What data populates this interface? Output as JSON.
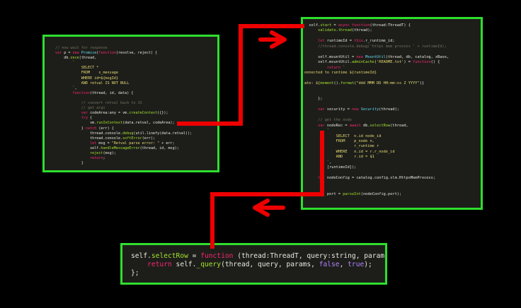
{
  "colors": {
    "background": "#000000",
    "panel_border": "#2ede2e",
    "panel_bg": "#1d1e1a",
    "connector": "#ee0000",
    "text": "#e6e6dc",
    "keyword": "#f92672",
    "function": "#a6e22e",
    "string": "#e6db74",
    "comment": "#75715e",
    "number": "#ae81ff",
    "type": "#66d9ef"
  },
  "panels": {
    "left": {
      "lines": [
        [
          [
            "comment",
            "// now wait for response"
          ]
        ],
        [
          [
            "keyword",
            "var"
          ],
          [
            "text",
            " p = "
          ],
          [
            "keyword",
            "new "
          ],
          [
            "type",
            "Promise"
          ],
          [
            "text",
            "("
          ],
          [
            "keyword",
            "function"
          ],
          [
            "text",
            "(resolve, reject) {"
          ]
        ],
        [
          [
            "text",
            "    db."
          ],
          [
            "function",
            "once"
          ],
          [
            "text",
            "(thread,"
          ]
        ],
        [
          [
            "string",
            "        `"
          ]
        ],
        [
          [
            "string",
            "            SELECT *"
          ]
        ],
        [
          [
            "string",
            "            FROM    x_message"
          ]
        ],
        [
          [
            "string",
            "            WHERE id=${msgId}"
          ]
        ],
        [
          [
            "string",
            "            AND retval IS NOT NULL"
          ]
        ],
        [
          [
            "string",
            "        `"
          ],
          [
            "text",
            ","
          ]
        ],
        [
          [
            "text",
            "        "
          ],
          [
            "keyword",
            "function"
          ],
          [
            "text",
            "(thread, id, data) {"
          ]
        ],
        [],
        [
          [
            "comment",
            "            // convert retval back to JS"
          ]
        ],
        [
          [
            "comment",
            "            // get args"
          ]
        ],
        [
          [
            "text",
            "            "
          ],
          [
            "keyword",
            "var"
          ],
          [
            "text",
            " codeArea:any = vm."
          ],
          [
            "function",
            "createContext"
          ],
          [
            "text",
            "({});"
          ]
        ],
        [
          [
            "text",
            "            "
          ],
          [
            "keyword",
            "try"
          ],
          [
            "text",
            " {"
          ]
        ],
        [
          [
            "text",
            "                vm."
          ],
          [
            "function",
            "runInContext"
          ],
          [
            "text",
            "(data.retval, codeArea);"
          ]
        ],
        [
          [
            "text",
            "            } "
          ],
          [
            "keyword",
            "catch"
          ],
          [
            "text",
            " (err) {"
          ]
        ],
        [
          [
            "text",
            "                thread.console."
          ],
          [
            "function",
            "debug"
          ],
          [
            "text",
            "(util.linefy(data.retval));"
          ]
        ],
        [
          [
            "text",
            "                thread.console."
          ],
          [
            "function",
            "softError"
          ],
          [
            "text",
            "(err);"
          ]
        ],
        [
          [
            "text",
            "                "
          ],
          [
            "keyword",
            "let"
          ],
          [
            "text",
            " msg = "
          ],
          [
            "string",
            "\"Retval parse error: \""
          ],
          [
            "text",
            " + err;"
          ]
        ],
        [
          [
            "text",
            "                self."
          ],
          [
            "function",
            "handleMessageError"
          ],
          [
            "text",
            "(thread, id, msg);"
          ]
        ],
        [
          [
            "text",
            "                "
          ],
          [
            "function",
            "reject"
          ],
          [
            "text",
            "(msg);"
          ]
        ],
        [
          [
            "text",
            "                "
          ],
          [
            "keyword",
            "return"
          ],
          [
            "text",
            ";"
          ]
        ],
        [
          [
            "text",
            "            }"
          ]
        ]
      ]
    },
    "right": {
      "lines": [
        [
          [
            "text",
            "  self."
          ],
          [
            "function",
            "start"
          ],
          [
            "text",
            " = "
          ],
          [
            "keyword",
            "async function"
          ],
          [
            "text",
            "(thread:ThreadT) {"
          ]
        ],
        [
          [
            "text",
            "      "
          ],
          [
            "function",
            "validate"
          ],
          [
            "text",
            "."
          ],
          [
            "function",
            "thread"
          ],
          [
            "text",
            "(thread);"
          ]
        ],
        [],
        [
          [
            "text",
            "      "
          ],
          [
            "keyword",
            "let"
          ],
          [
            "text",
            " runtimeId = "
          ],
          [
            "keyword",
            "this"
          ],
          [
            "text",
            ".r_runtime_id;"
          ]
        ],
        [
          [
            "comment",
            "      //thread.console.debug('https mem process ' + runtimeId);"
          ]
        ],
        [],
        [
          [
            "text",
            "      self.mountUtil = "
          ],
          [
            "keyword",
            "new "
          ],
          [
            "type",
            "MountUtil"
          ],
          [
            "text",
            "(thread, db, catalog, xBase,"
          ]
        ],
        [
          [
            "text",
            "      self.mountUtil."
          ],
          [
            "function",
            "adminCache"
          ],
          [
            "text",
            "("
          ],
          [
            "string",
            "'README.txt'"
          ],
          [
            "text",
            ") = "
          ],
          [
            "keyword",
            "function"
          ],
          [
            "text",
            "() {"
          ]
        ],
        [
          [
            "text",
            "          "
          ],
          [
            "keyword",
            "return"
          ],
          [
            "string",
            " `"
          ]
        ],
        [
          [
            "string",
            "onnected to runtime ${runtimeId}"
          ]
        ],
        [],
        [
          [
            "string",
            "ate: ${"
          ],
          [
            "function",
            "moment"
          ],
          [
            "text",
            "()."
          ],
          [
            "function",
            "format"
          ],
          [
            "text",
            "("
          ],
          [
            "string",
            "\"ddd MMM DD HH:mm:ss Z YYYY\""
          ],
          [
            "text",
            ")}"
          ]
        ],
        [],
        [],
        [
          [
            "text",
            "      };"
          ]
        ],
        [],
        [
          [
            "text",
            "      "
          ],
          [
            "keyword",
            "var"
          ],
          [
            "text",
            " security = "
          ],
          [
            "keyword",
            "new "
          ],
          [
            "type",
            "Security"
          ],
          [
            "text",
            "(thread);"
          ]
        ],
        [],
        [
          [
            "comment",
            "      // get the node"
          ]
        ],
        [
          [
            "text",
            "      "
          ],
          [
            "keyword",
            "var"
          ],
          [
            "text",
            " nodeRec = "
          ],
          [
            "keyword",
            "await"
          ],
          [
            "text",
            " db."
          ],
          [
            "function",
            "selectRow"
          ],
          [
            "text",
            "(thread,"
          ]
        ],
        [
          [
            "string",
            "          `"
          ]
        ],
        [
          [
            "string",
            "              SELECT  n.id node_id"
          ]
        ],
        [
          [
            "string",
            "              FROM    p_node n,"
          ]
        ],
        [
          [
            "string",
            "                      r_runtime r"
          ]
        ],
        [
          [
            "string",
            "              WHERE   n.id = r.r_node_id"
          ]
        ],
        [
          [
            "string",
            "              AND     r.id = $1"
          ]
        ],
        [
          [
            "string",
            "          `"
          ],
          [
            "text",
            ","
          ]
        ],
        [
          [
            "text",
            "          [runtimeId]);"
          ]
        ],
        [],
        [
          [
            "text",
            "      "
          ],
          [
            "keyword",
            "let"
          ],
          [
            "text",
            " nodeConfig = catalog.config.slm.HttpsMemProcess;"
          ]
        ],
        [],
        [],
        [
          [
            "text",
            "      "
          ],
          [
            "keyword",
            "let"
          ],
          [
            "text",
            " port = "
          ],
          [
            "function",
            "parseInt"
          ],
          [
            "text",
            "(nodeConfig.port);"
          ]
        ]
      ]
    },
    "bottom": {
      "lines": [
        [
          [
            "text",
            "self."
          ],
          [
            "function",
            "selectRow"
          ],
          [
            "text",
            " = "
          ],
          [
            "keyword",
            "function"
          ],
          [
            "text",
            " (thread:ThreadT, query:string, params"
          ]
        ],
        [
          [
            "text",
            "    "
          ],
          [
            "keyword",
            "return"
          ],
          [
            "text",
            " self."
          ],
          [
            "function",
            "_query"
          ],
          [
            "text",
            "(thread, query, params, "
          ],
          [
            "number",
            "false"
          ],
          [
            "text",
            ", "
          ],
          [
            "number",
            "true"
          ],
          [
            "text",
            ");"
          ]
        ],
        [
          [
            "text",
            "};"
          ]
        ]
      ]
    }
  }
}
